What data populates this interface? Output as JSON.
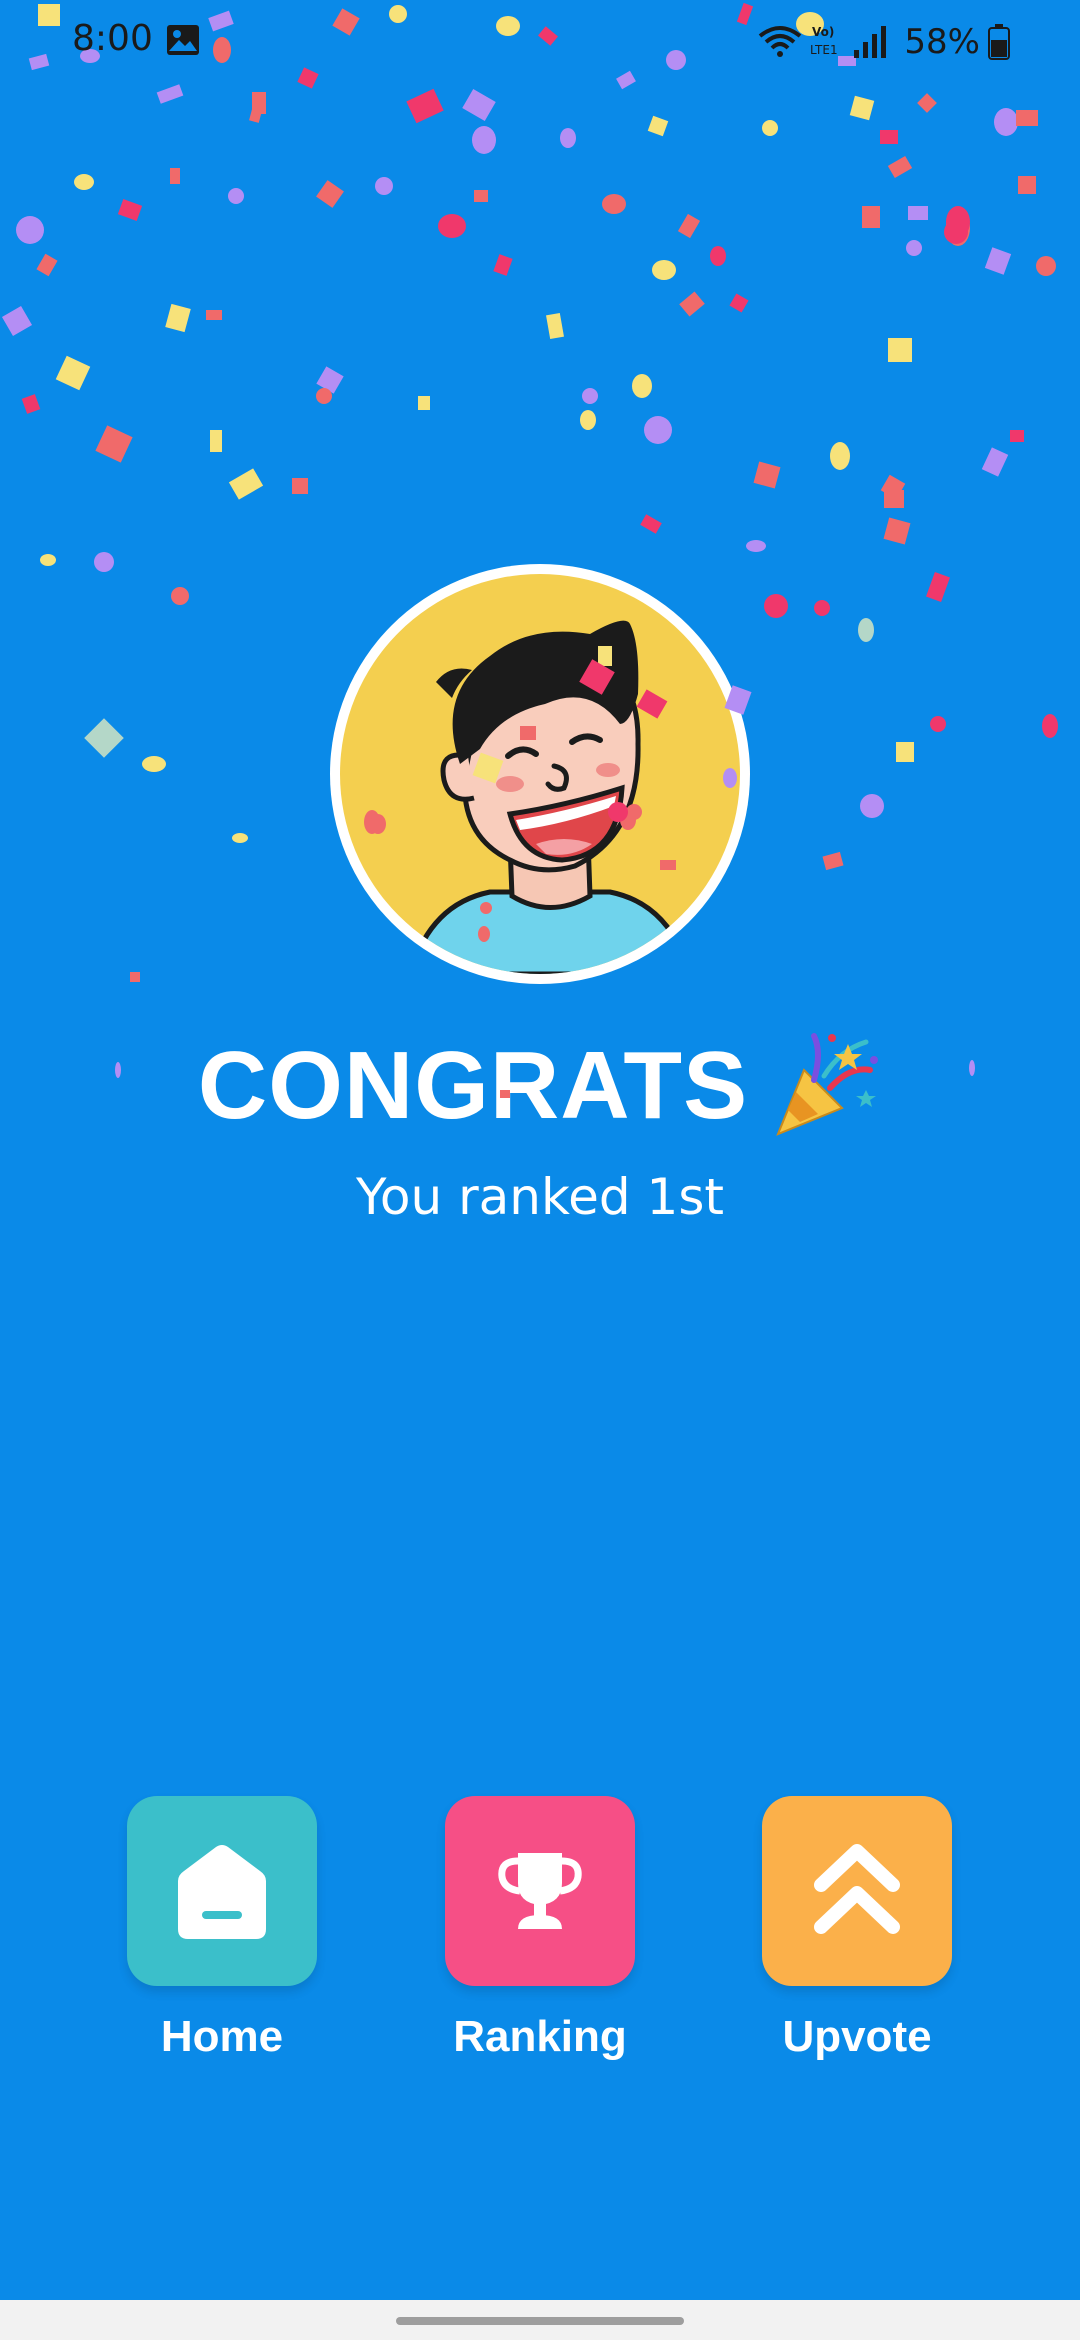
{
  "status_bar": {
    "time": "8:00",
    "battery_percent": "58%",
    "gallery_icon": "image-icon",
    "wifi_icon": "wifi-icon",
    "lte_icon": "volte-lte-icon",
    "signal_icon": "signal-bars-icon",
    "battery_icon": "battery-icon"
  },
  "hero": {
    "avatar_icon": "smiling-man-avatar",
    "title": "CONGRATS",
    "title_icon": "party-popper-emoji",
    "subtitle": "You ranked 1st"
  },
  "actions": [
    {
      "label": "Home",
      "icon": "home-icon",
      "color": "#3bbfca"
    },
    {
      "label": "Ranking",
      "icon": "trophy-icon",
      "color": "#f64f86"
    },
    {
      "label": "Upvote",
      "icon": "double-chevron-up-icon",
      "color": "#fbb04a"
    }
  ],
  "colors": {
    "background": "#0a8ae8",
    "avatar_bg": "#f4cf4f",
    "text": "#ffffff",
    "confetti": [
      "#f06a6a",
      "#f7e27a",
      "#b48ef4",
      "#f0386b"
    ]
  }
}
